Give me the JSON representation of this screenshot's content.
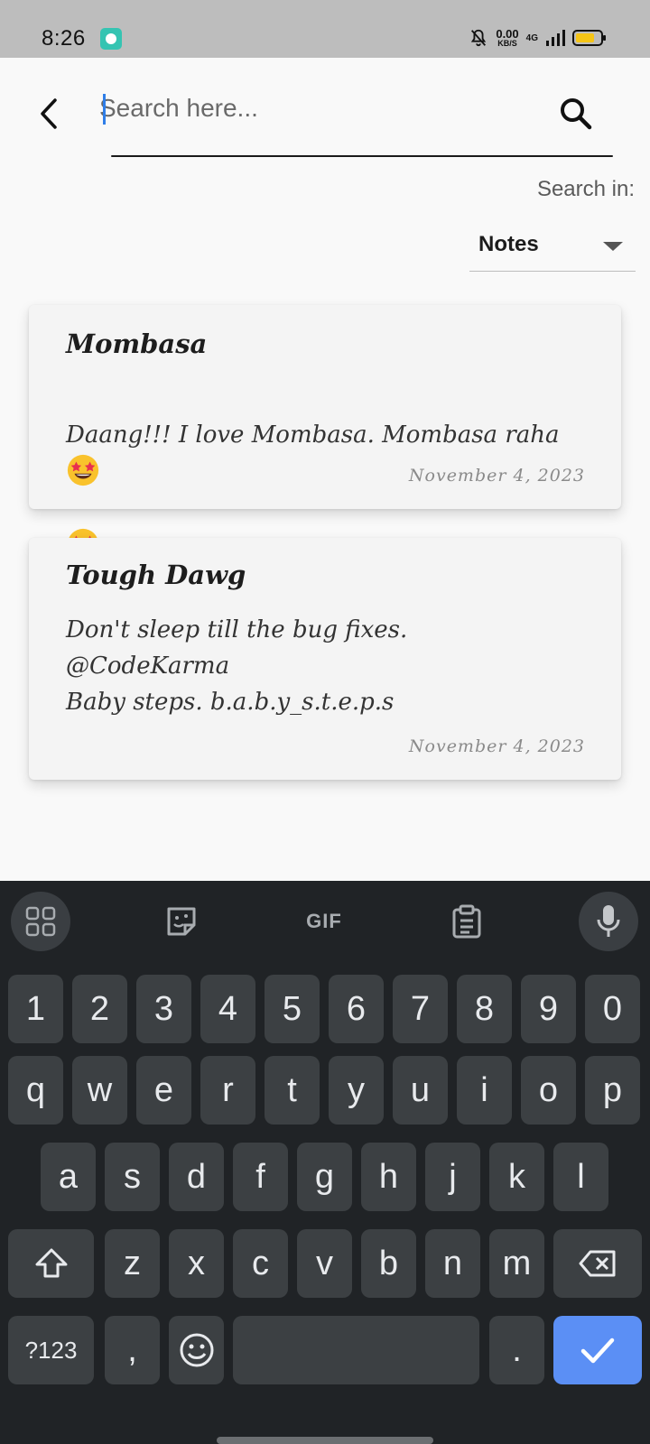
{
  "status_bar": {
    "time": "8:26",
    "speed_value": "0.00",
    "speed_unit": "KB/S",
    "network": "4G",
    "battery_level": 0.75,
    "battery_color": "#f5c517"
  },
  "search": {
    "placeholder": "Search here...",
    "value": "",
    "back_icon": "back-arrow-icon",
    "search_icon": "search-icon"
  },
  "filter": {
    "label": "Search in:",
    "selected": "Notes"
  },
  "notes": [
    {
      "title": "Mombasa",
      "body": "Daang!!! I love Mombasa. Mombasa raha",
      "date": "November 4, 2023",
      "emojis": [
        "star-struck-emoji",
        "star-struck-emoji"
      ]
    },
    {
      "title": "Tough Dawg",
      "body": "Don't sleep till the bug fixes.\n@CodeKarma\nBaby steps. b.a.b.y_s.t.e.p.s",
      "date": "November 4, 2023"
    }
  ],
  "keyboard": {
    "toolbar": {
      "gif_label": "GIF"
    },
    "row_numbers": [
      "1",
      "2",
      "3",
      "4",
      "5",
      "6",
      "7",
      "8",
      "9",
      "0"
    ],
    "row_1": [
      "q",
      "w",
      "e",
      "r",
      "t",
      "y",
      "u",
      "i",
      "o",
      "p"
    ],
    "row_2": [
      "a",
      "s",
      "d",
      "f",
      "g",
      "h",
      "j",
      "k",
      "l"
    ],
    "row_3": [
      "z",
      "x",
      "c",
      "v",
      "b",
      "n",
      "m"
    ],
    "symbols_label": "?123",
    "comma": ",",
    "period": ".",
    "accent_color": "#5b8ff5"
  }
}
